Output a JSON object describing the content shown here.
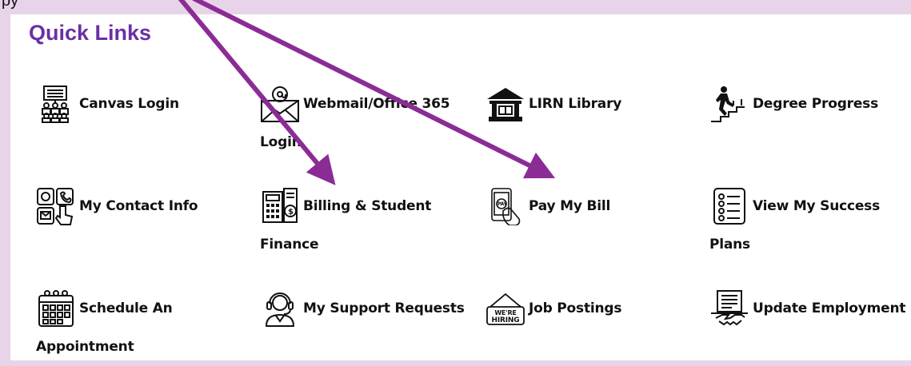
{
  "top_fragment": "py",
  "section_title": "Quick Links",
  "links": [
    {
      "label": "Canvas Login",
      "icon": "presentation-audience-icon"
    },
    {
      "label": "Webmail/Office 365 Login",
      "icon": "email-envelope-icon"
    },
    {
      "label": "LIRN Library",
      "icon": "library-building-icon"
    },
    {
      "label": "Degree Progress",
      "icon": "climbing-stairs-icon"
    },
    {
      "label": "My Contact Info",
      "icon": "contact-card-icon"
    },
    {
      "label": "Billing & Student Finance",
      "icon": "calculator-invoice-icon"
    },
    {
      "label": "Pay My Bill",
      "icon": "phone-pay-icon"
    },
    {
      "label": "View My Success Plans",
      "icon": "checklist-icon"
    },
    {
      "label": "Schedule An Appointment",
      "icon": "calendar-icon"
    },
    {
      "label": "My Support Requests",
      "icon": "headset-support-icon"
    },
    {
      "label": "Job Postings",
      "icon": "hiring-sign-icon"
    },
    {
      "label": "Update Employment",
      "icon": "handshake-document-icon"
    }
  ],
  "colors": {
    "background": "#e8d4e8",
    "title": "#6b2fa3",
    "arrow": "#8b2c96",
    "text": "#111111"
  }
}
